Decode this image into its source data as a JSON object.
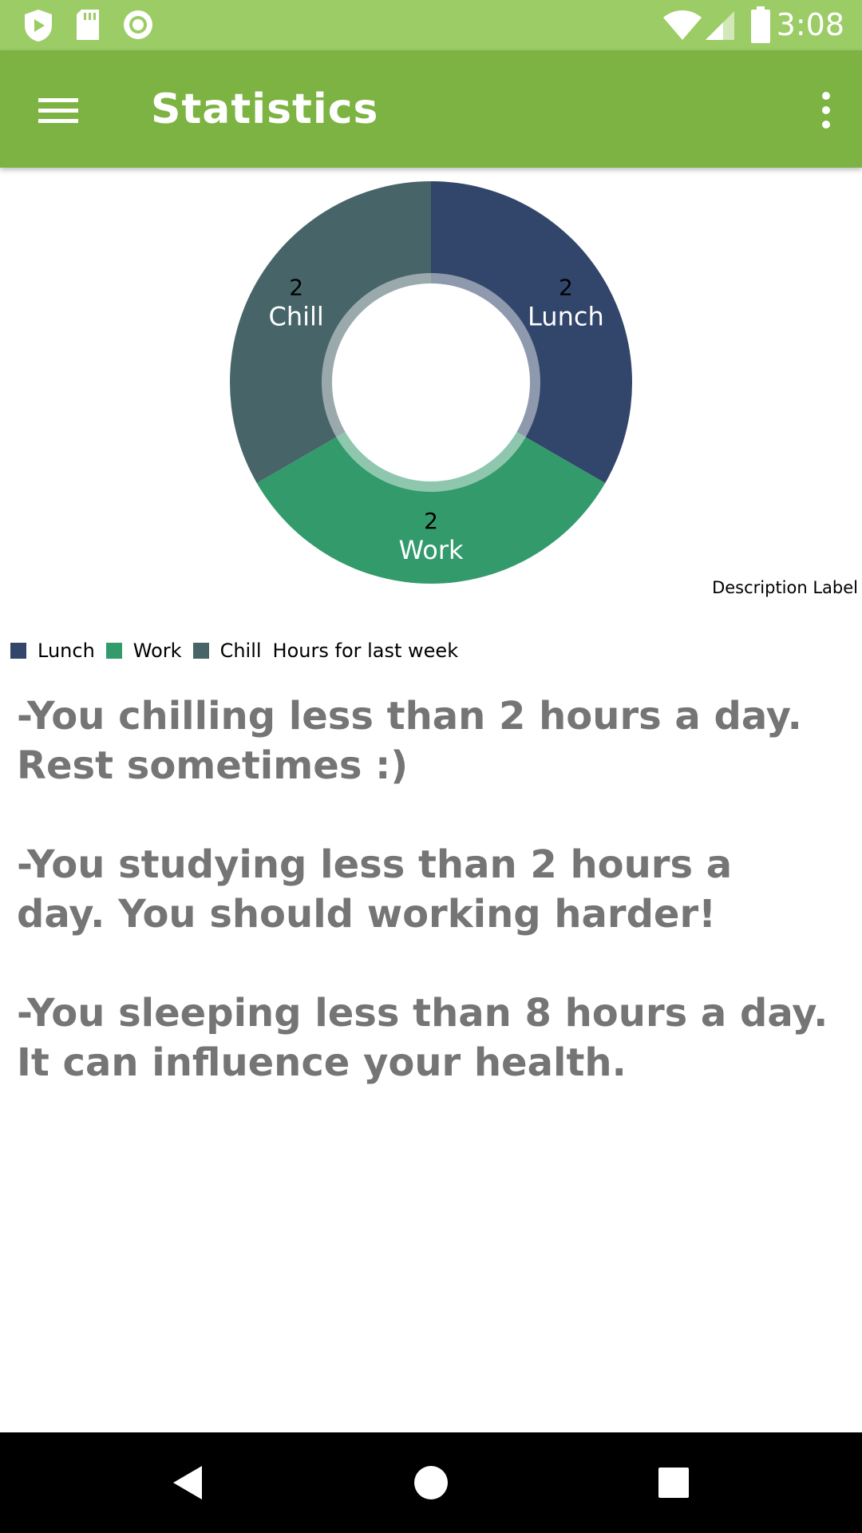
{
  "status_bar": {
    "time": "3:08",
    "left_icons": [
      "shield-play-icon",
      "sd-card-icon",
      "circle-record-icon"
    ],
    "right_icons": [
      "wifi-icon",
      "cell-signal-icon",
      "battery-icon"
    ]
  },
  "app_bar": {
    "title": "Statistics",
    "menu_icon": "hamburger-menu-icon",
    "overflow_icon": "more-vert-icon",
    "color": "#7cb342"
  },
  "chart_data": {
    "type": "pie",
    "donut": true,
    "slices": [
      {
        "label": "Lunch",
        "value": 2,
        "color": "#32456a"
      },
      {
        "label": "Work",
        "value": 2,
        "color": "#329a6b"
      },
      {
        "label": "Chill",
        "value": 2,
        "color": "#476568"
      }
    ],
    "description": "Description Label",
    "legend": {
      "placement": "bottom-left",
      "entries": [
        "Lunch",
        "Work",
        "Chill"
      ],
      "description": "Hours for last week"
    }
  },
  "messages": [
    "-You chilling less than 2 hours a day.\nRest sometimes :)",
    "-You studying less than 2 hours a day. You should working harder!",
    "-You sleeping less than 8 hours a day. It can influence your health."
  ],
  "nav_bar": {
    "icons": [
      "back-icon",
      "home-icon",
      "recents-icon"
    ]
  }
}
